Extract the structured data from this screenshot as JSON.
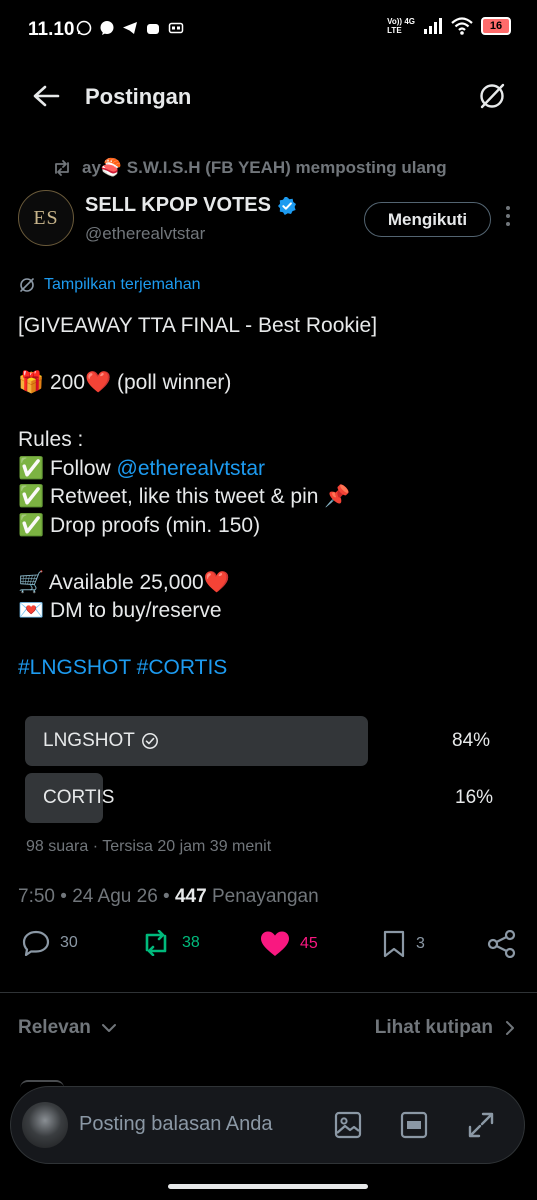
{
  "status_bar": {
    "time": "11.10",
    "network_top": "Vo)) 4G",
    "network_bottom": "LTE",
    "battery": "16"
  },
  "header": {
    "title": "Postingan"
  },
  "repost": {
    "text": "ay🍣 S.W.I.S.H (FB YEAH) memposting ulang"
  },
  "author": {
    "avatar_text": "ES",
    "name": "SELL KPOP VOTES",
    "handle": "@etherealvtstar",
    "follow_label": "Mengikuti",
    "verified_color": "#1d9bf0"
  },
  "translate_label": "Tampilkan terjemahan",
  "tweet": {
    "title": "[GIVEAWAY TTA FINAL - Best Rookie]",
    "prize": "🎁 200❤️ (poll winner)",
    "rules_heading": "Rules :",
    "rule1_prefix": "✅ Follow ",
    "rule1_mention": "@etherealvtstar",
    "rule2": "✅ Retweet, like this tweet & pin 📌",
    "rule3": "✅ Drop proofs (min. 150)",
    "available": "🛒 Available 25,000❤️",
    "dm": "💌 DM to buy/reserve",
    "hashtags": "#LNGSHOT #CORTIS"
  },
  "poll": {
    "options": [
      {
        "label": "LNGSHOT",
        "percent": "84%",
        "fraction": 0.84,
        "winner": true
      },
      {
        "label": "CORTIS",
        "percent": "16%",
        "fraction": 0.16,
        "winner": false
      }
    ],
    "meta": "98 suara · Tersisa 20 jam 39 menit"
  },
  "timestamp": {
    "time": "7:50 • 24 Agu 26 • ",
    "views": "447",
    "views_label": " Penayangan"
  },
  "actions": {
    "replies": "30",
    "reposts": "38",
    "likes": "45",
    "bookmarks": "3",
    "repost_color": "#00ba7c",
    "like_color": "#f91880"
  },
  "filter": {
    "left": "Relevan",
    "right": "Lihat kutipan"
  },
  "reply": {
    "placeholder": "Posting balasan Anda"
  }
}
